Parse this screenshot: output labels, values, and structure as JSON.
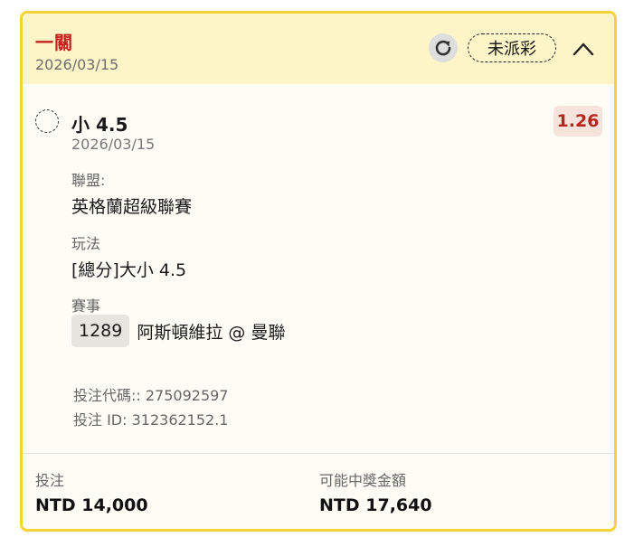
{
  "header": {
    "bet_type": "一關",
    "date": "2026/03/15",
    "status": "未派彩"
  },
  "selection": {
    "name": "小 4.5",
    "date": "2026/03/15",
    "odds": "1.26"
  },
  "league": {
    "label": "聯盟:",
    "value": "英格蘭超級聯賽"
  },
  "play": {
    "label": "玩法",
    "value": "[總分]大小 4.5"
  },
  "event": {
    "label": "賽事",
    "id": "1289",
    "name": "阿斯頓維拉 @ 曼聯"
  },
  "codes": {
    "bet_code": "投注代碼:: 275092597",
    "bet_id": "投注 ID: 312362152.1"
  },
  "footer": {
    "stake_label": "投注",
    "stake_value": "NTD 14,000",
    "payout_label": "可能中獎金額",
    "payout_value": "NTD 17,640"
  },
  "colors": {
    "border": "#f3d23a",
    "header_bg": "#fdf4c8",
    "accent_red": "#c1211c",
    "odds_bg": "#f6e3dc"
  },
  "icons": {
    "refresh": "refresh-icon",
    "collapse": "chevron-up-icon",
    "selection": "dashed-circle-icon"
  }
}
